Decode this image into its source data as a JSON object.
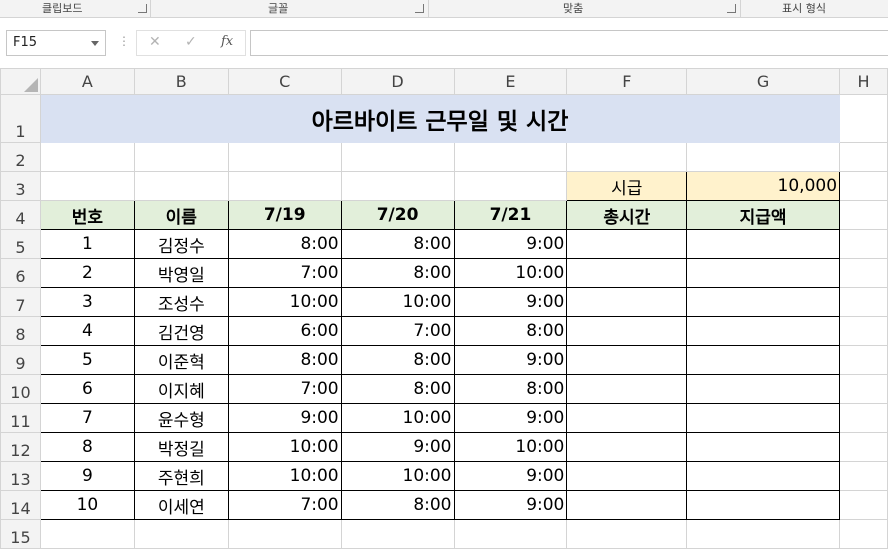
{
  "ribbon": {
    "groups": [
      "클립보드",
      "글꼴",
      "맞춤",
      "표시 형식"
    ]
  },
  "formula_bar": {
    "name_box": "F15",
    "cancel_glyph": "✕",
    "enter_glyph": "✓",
    "fx_glyph": "fx",
    "content": ""
  },
  "columns": [
    "A",
    "B",
    "C",
    "D",
    "E",
    "F",
    "G",
    "H"
  ],
  "rows": [
    "1",
    "2",
    "3",
    "4",
    "5",
    "6",
    "7",
    "8",
    "9",
    "10",
    "11",
    "12",
    "13",
    "14",
    "15"
  ],
  "sheet": {
    "title": "아르바이트 근무일 및 시간",
    "wage_label": "시급",
    "wage_value": "10,000",
    "headers": [
      "번호",
      "이름",
      "7/19",
      "7/20",
      "7/21",
      "총시간",
      "지급액"
    ],
    "records": [
      [
        "1",
        "김정수",
        "8:00",
        "8:00",
        "9:00"
      ],
      [
        "2",
        "박영일",
        "7:00",
        "8:00",
        "10:00"
      ],
      [
        "3",
        "조성수",
        "10:00",
        "10:00",
        "9:00"
      ],
      [
        "4",
        "김건영",
        "6:00",
        "7:00",
        "8:00"
      ],
      [
        "5",
        "이준혁",
        "8:00",
        "8:00",
        "9:00"
      ],
      [
        "6",
        "이지혜",
        "7:00",
        "8:00",
        "8:00"
      ],
      [
        "7",
        "윤수형",
        "9:00",
        "10:00",
        "9:00"
      ],
      [
        "8",
        "박정길",
        "10:00",
        "9:00",
        "10:00"
      ],
      [
        "9",
        "주현희",
        "10:00",
        "10:00",
        "9:00"
      ],
      [
        "10",
        "이세연",
        "7:00",
        "8:00",
        "9:00"
      ]
    ]
  },
  "colors": {
    "title_fill": "#d9e1f2",
    "header_fill": "#e2efda",
    "wage_fill": "#fff2cc",
    "grid_line": "#d4d4d4"
  }
}
